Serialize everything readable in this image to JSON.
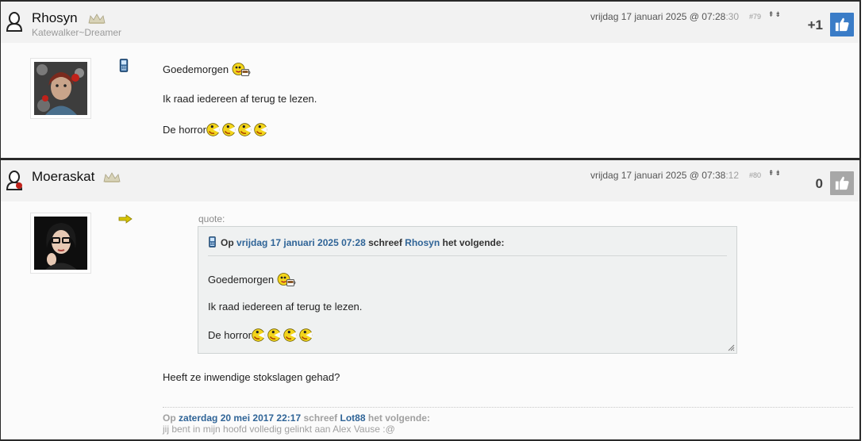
{
  "posts": [
    {
      "username": "Rhosyn",
      "user_title": "Katewalker~Dreamer",
      "date_main": "vrijdag 17 januari 2025 @ 07:28",
      "date_seconds": ":30",
      "post_number": "#79",
      "sort_arrows": "⇞⇟",
      "score": "+1",
      "liked": true,
      "lines": [
        "Goedemorgen",
        "Ik raad iedereen af terug te lezen.",
        "De horror"
      ]
    },
    {
      "username": "Moeraskat",
      "date_main": "vrijdag 17 januari 2025 @ 07:38",
      "date_seconds": ":12",
      "post_number": "#80",
      "sort_arrows": "⇞⇟",
      "score": "0",
      "liked": false,
      "quote": {
        "label": "quote:",
        "prefix": "Op",
        "date_link": "vrijdag 17 januari 2025 07:28",
        "middle": "schreef",
        "author_link": "Rhosyn",
        "suffix": "het volgende:",
        "lines": [
          "Goedemorgen",
          "Ik raad iedereen af terug te lezen.",
          "De horror"
        ]
      },
      "reply": "Heeft ze inwendige stokslagen gehad?",
      "signature": {
        "prefix": "Op",
        "date_link": "zaterdag 20 mei 2017 22:17",
        "middle": "schreef",
        "author_link": "Lot88",
        "suffix": "het volgende:",
        "text": "jij bent in mijn hoofd volledig gelinkt aan Alex Vause :@"
      }
    }
  ],
  "colors": {
    "like_active": "#3a7cc7",
    "like_inactive": "#a7a7a7",
    "link": "#2f6497",
    "smiley_yellow": "#f3d51b"
  },
  "icons": [
    "user-silhouette-icon",
    "user-silhouette-red-icon",
    "rank-crown-icon",
    "mobile-phone-icon",
    "yellow-arrow-icon",
    "thumbs-up-icon",
    "coffee-smiley-icon",
    "pacman-smiley-icon",
    "resize-grip-icon"
  ]
}
